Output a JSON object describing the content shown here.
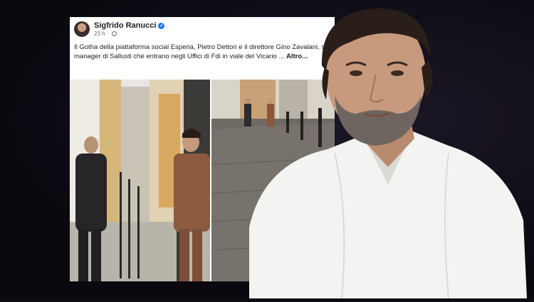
{
  "post": {
    "author": "Sigfrido Ranucci",
    "time": "23 h",
    "text_line1": "Il Gotha della piattaforma social Esperia, Pietro Dettori e il direttore Gino Zavalani, soci",
    "text_line2": "manager di Sallusti che entrano negli Uffici di Fdi in viale del Vicario ...",
    "more_label": "Altro..."
  },
  "icons": {
    "verified": "verified-badge-icon",
    "privacy": "globe-icon"
  },
  "colors": {
    "background": "#0d0c13",
    "verified": "#1877f2"
  }
}
